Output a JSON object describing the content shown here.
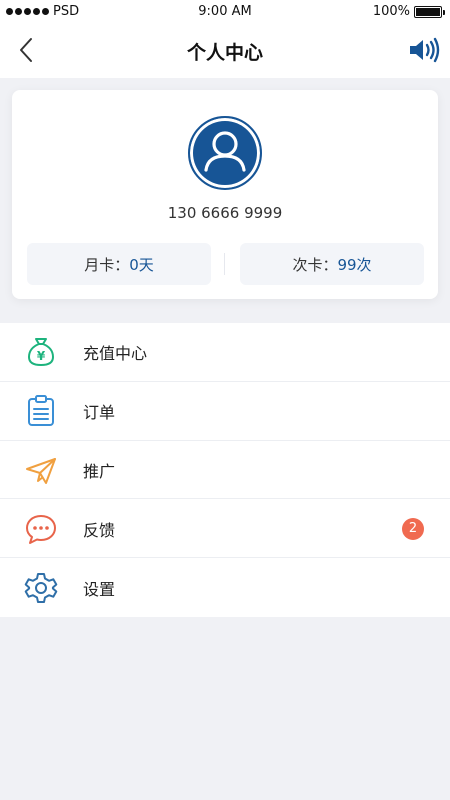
{
  "status_bar": {
    "carrier": "PSD",
    "time": "9:00 AM",
    "battery": "100%"
  },
  "nav": {
    "title": "个人中心"
  },
  "profile": {
    "phone": "130 6666 9999",
    "monthly_card": {
      "label": "月卡：",
      "value": "0天"
    },
    "count_card": {
      "label": "次卡：",
      "value": "99次"
    }
  },
  "menu": {
    "items": [
      {
        "label": "充值中心",
        "icon": "money-bag-icon"
      },
      {
        "label": "订单",
        "icon": "clipboard-list-icon"
      },
      {
        "label": "推广",
        "icon": "paper-plane-icon"
      },
      {
        "label": "反馈",
        "icon": "chat-bubble-icon",
        "badge": "2"
      },
      {
        "label": "设置",
        "icon": "gear-icon"
      }
    ]
  },
  "colors": {
    "accent": "#175596",
    "background": "#f0f1f5",
    "recharge_icon": "#1db37d",
    "order_icon": "#3a8fd6",
    "promo_icon": "#f0a040",
    "feedback_icon": "#e8644a",
    "settings_icon": "#2f6fa8",
    "badge": "#f06a50"
  }
}
